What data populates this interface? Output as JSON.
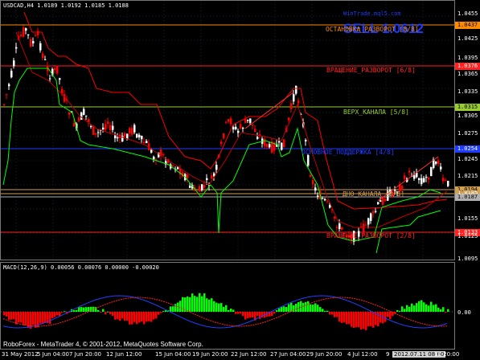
{
  "chart": {
    "title": "USDCAD,H4  1.0189 1.0192 1.0185 1.0188",
    "watermark_url": "WinTrade.mql5.com",
    "watermark_small": "",
    "watermark_big": "SELL 1.0612",
    "footer": "RoboForex - MetaTrader 4, © 2001-2012, MetaQuotes Software Corp."
  },
  "levels": [
    {
      "label": "ОСТАНОВКА_РАЗВОРОТ [8/8]",
      "price_tag": "1.0437",
      "color": "#ff8c00",
      "tag_bg": "#ff8c00",
      "tag_color": "#000000"
    },
    {
      "label": "ВРАЩЕНИЕ_РАЗВОРОТ [6/8]",
      "price_tag": "1.0376",
      "color": "#ff2020",
      "tag_bg": "#ff2020",
      "tag_color": "#ffffff"
    },
    {
      "label": "ВЕРХ_КАНАЛА [5/8]",
      "price_tag": "1.0315",
      "color": "#9acd32",
      "tag_bg": "#9acd32",
      "tag_color": "#000000"
    },
    {
      "label": "ОСНОВНОЕ_ПОДДЕРЖКА [4/8]",
      "price_tag": "1.0254",
      "color": "#1e3cff",
      "tag_bg": "#1e3cff",
      "tag_color": "#ffffff"
    },
    {
      "label": "ДНО_КАНАЛА [3/8]",
      "price_tag": "1.0194",
      "color": "#d2a050",
      "tag_bg": "#d2a050",
      "tag_color": "#000000"
    },
    {
      "label": "ВРАЩЕНИЕ_РАЗВОРОТ [2/8]",
      "price_tag": "1.0133",
      "color": "#ff2020",
      "tag_bg": "#ff2020",
      "tag_color": "#ffffff"
    }
  ],
  "extra_tag": {
    "price_tag": "1.0187",
    "bg": "#b0b0b0",
    "color": "#000000"
  },
  "price_axis": [
    "1.0455",
    "1.0425",
    "1.0395",
    "1.0365",
    "1.0335",
    "1.0305",
    "1.0275",
    "1.0245",
    "1.0215",
    "1.0185",
    "1.0155",
    "1.0125",
    "1.0095"
  ],
  "macd": {
    "label": "MACD(12,26,9) 0.00056 0.00076 0.00000 -0.00020",
    "axis": [
      "0.00",
      "0.00"
    ]
  },
  "time_axis": [
    "31 May 2012",
    "5 Jun 04:00",
    "7 Jun 20:00",
    "12 Jun 12:00",
    "15 Jun 04:00",
    "19 Jun 20:00",
    "22 Jun 12:00",
    "27 Jun 04:00",
    "29 Jun 20:00",
    "4 Jul 12:00",
    "9",
    "2012.07.11 08:00",
    "12 20:00"
  ],
  "colors": {
    "bull": "#ffffff",
    "bear": "#ff0000",
    "green_line": "#00ff00",
    "red_line": "#ff0000",
    "grid": "#0a2a2a",
    "macd_pos": "#00ff00",
    "macd_neg": "#ff0000"
  }
}
